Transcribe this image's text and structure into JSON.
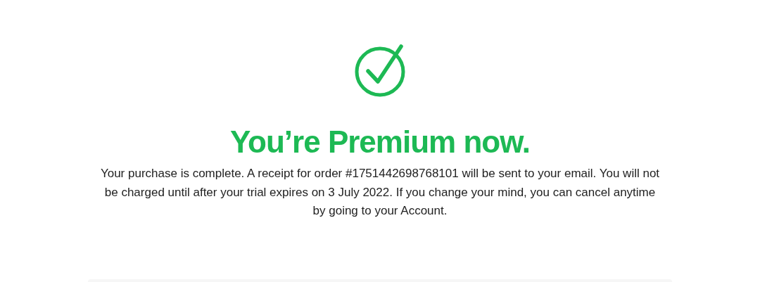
{
  "title": "You’re Premium now.",
  "message": "Your purchase is complete. A receipt for order #1751442698768101 will be sent to your email. You will not be charged until after your trial expires on 3 July 2022. If you change your mind, you can cancel anytime by going to your Account."
}
